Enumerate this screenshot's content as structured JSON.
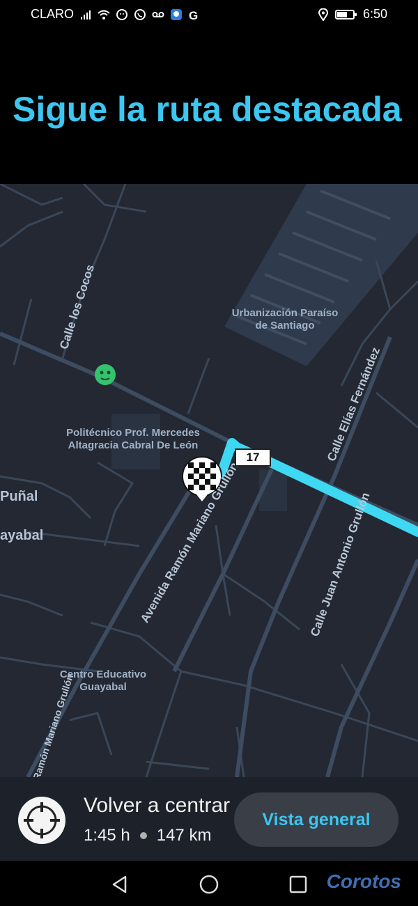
{
  "status_bar": {
    "carrier": "CLARO",
    "time": "6:50"
  },
  "header": {
    "title": "Sigue la ruta destacada"
  },
  "map": {
    "places": {
      "urbanizacion": "Urbanización Paraíso de Santiago",
      "politecnico": "Politécnico Prof. Mercedes Altagracia Cabral De León",
      "centro_educativo": "Centro Educativo Guayabal",
      "punal": "Puñal",
      "guayabal": "ayabal"
    },
    "streets": {
      "calle_cocos": "Calle los Cocos",
      "avenida": "Avenida Ramón Mariano Grullón",
      "calle_elias": "Calle Elías Fernández",
      "calle_juan": "Calle Juan Antonio Grullón",
      "ramon_lower": "Ramón Mariano Grullón"
    },
    "route_shield": "17",
    "colors": {
      "route": "#3ed8f2",
      "background": "#232832",
      "roads": "#3d4c60"
    }
  },
  "bottom_panel": {
    "recenter_label": "Volver a centrar",
    "duration": "1:45 h",
    "distance": "147 km",
    "overview_button": "Vista general"
  },
  "watermark": "Corotos"
}
